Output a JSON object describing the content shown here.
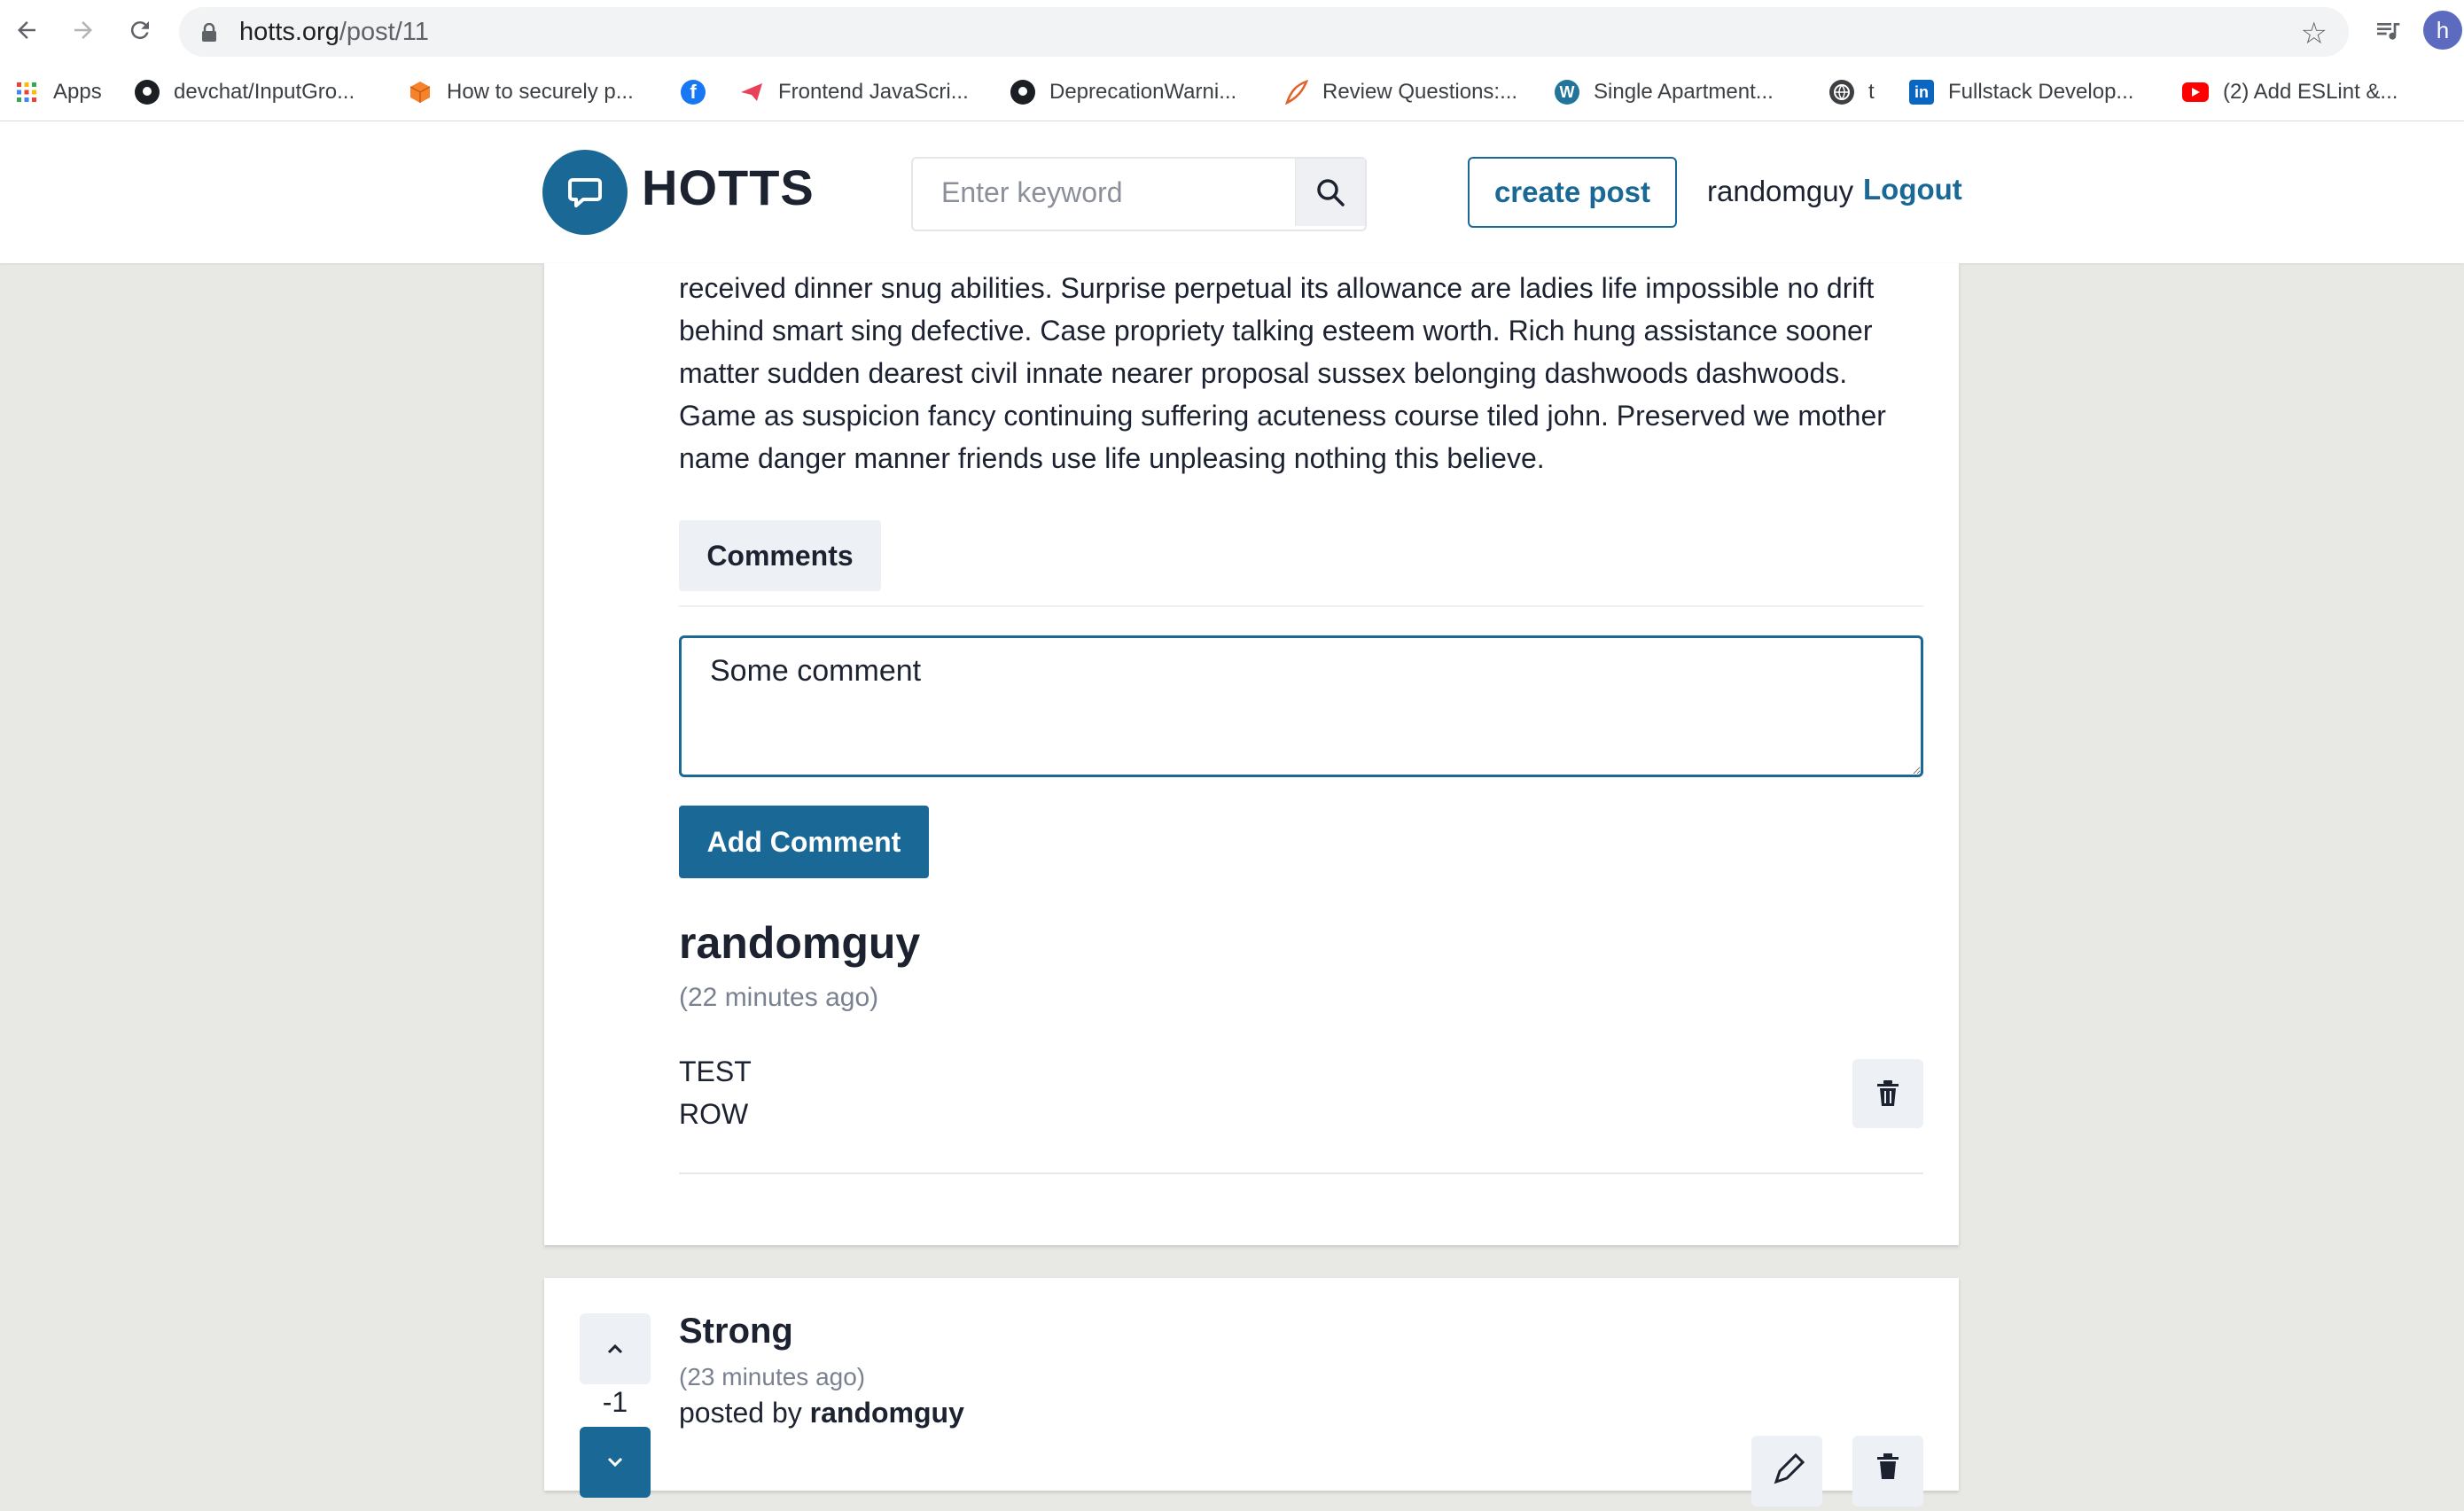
{
  "browser": {
    "url_host": "hotts.org",
    "url_path": "/post/11",
    "profile_initial": "h",
    "bookmarks": [
      {
        "label": "Apps",
        "icon": "apps-grid-icon"
      },
      {
        "label": "devchat/InputGro...",
        "icon": "github-icon"
      },
      {
        "label": "How to securely p...",
        "icon": "cube-icon"
      },
      {
        "label": "",
        "icon": "facebook-icon"
      },
      {
        "label": "Frontend JavaScri...",
        "icon": "paper-plane-icon"
      },
      {
        "label": "DeprecationWarni...",
        "icon": "github-icon"
      },
      {
        "label": "Review Questions:...",
        "icon": "feather-icon"
      },
      {
        "label": "Single Apartment...",
        "icon": "wordpress-icon"
      },
      {
        "label": "t",
        "icon": "globe-icon"
      },
      {
        "label": "Fullstack Develop...",
        "icon": "linkedin-icon"
      },
      {
        "label": "(2) Add ESLint &...",
        "icon": "youtube-icon"
      }
    ]
  },
  "header": {
    "logo_text": "HOTTS",
    "search_placeholder": "Enter keyword",
    "create_post_label": "create post",
    "username": "randomguy",
    "logout_label": "Logout"
  },
  "post": {
    "body_lines": [
      "received dinner snug abilities. Surprise perpetual its allowance are ladies life impossible no drift",
      "behind smart sing defective. Case propriety talking esteem worth. Rich hung assistance sooner",
      "matter sudden dearest civil innate nearer proposal sussex belonging dashwoods dashwoods.",
      "Game as suspicion fancy continuing suffering acuteness course tiled john. Preserved we mother",
      "name danger manner friends use life unpleasing nothing this believe."
    ],
    "comments_tab_label": "Comments",
    "comment_input_value": "Some comment",
    "add_comment_label": "Add Comment",
    "comments": [
      {
        "author": "randomguy",
        "time": "(22 minutes ago)",
        "lines": [
          "TEST",
          "ROW"
        ]
      }
    ]
  },
  "next_post": {
    "title": "Strong",
    "time": "(23 minutes ago)",
    "posted_by_prefix": "posted by",
    "author": "randomguy",
    "score": "-1"
  },
  "colors": {
    "primary": "#1a6896",
    "page_bg": "#e8e9e5",
    "text": "#1c2230",
    "muted": "#7a8190"
  }
}
